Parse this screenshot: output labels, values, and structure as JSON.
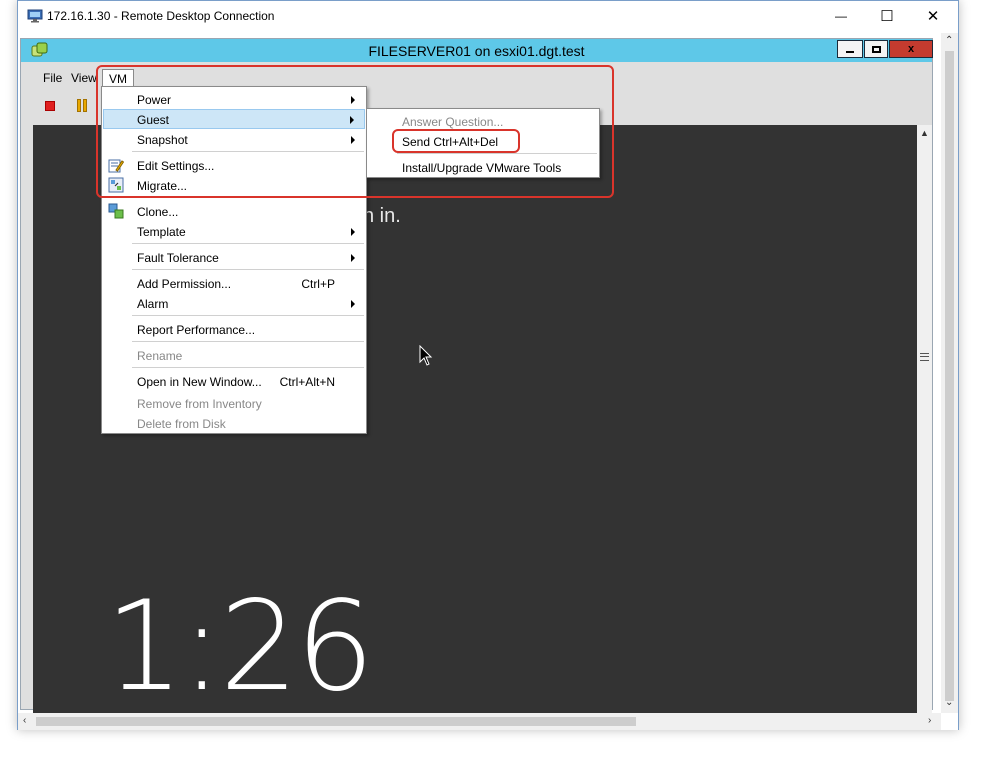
{
  "rdp": {
    "title": "172.16.1.30 - Remote Desktop Connection",
    "minimize_glyph": "—",
    "maximize_glyph": "☐",
    "close_glyph": "✕"
  },
  "vsphere": {
    "title": "FILESERVER01 on esxi01.dgt.test",
    "close_glyph": "x"
  },
  "menubar": {
    "file": "File",
    "view": "View",
    "vm": "VM"
  },
  "vm_menu": {
    "power": "Power",
    "guest": "Guest",
    "snapshot": "Snapshot",
    "edit_settings": "Edit Settings...",
    "migrate": "Migrate...",
    "clone": "Clone...",
    "template": "Template",
    "fault_tolerance": "Fault Tolerance",
    "add_permission": "Add Permission...",
    "add_permission_shortcut": "Ctrl+P",
    "alarm": "Alarm",
    "report_performance": "Report Performance...",
    "rename": "Rename",
    "open_new_window": "Open in New Window...",
    "open_new_window_shortcut": "Ctrl+Alt+N",
    "remove_inventory": "Remove from Inventory",
    "delete_disk": "Delete from Disk"
  },
  "guest_menu": {
    "answer_question": "Answer Question...",
    "send_cad": "Send Ctrl+Alt+Del",
    "install_tools": "Install/Upgrade VMware Tools"
  },
  "lockscreen": {
    "signin_partial": "n in.",
    "time": "1:26"
  },
  "colors": {
    "titlebar": "#5ec8e8",
    "console_bg": "#333333",
    "annotation": "#d9342b",
    "menu_highlight": "#cde6f7"
  },
  "icons": {
    "rdp_app": "rdp-monitor-icon",
    "vsphere": "vsphere-icon",
    "stop": "stop-icon",
    "pause": "pause-icon",
    "edit_settings": "edit-settings-icon",
    "migrate": "migrate-icon",
    "clone": "clone-icon"
  }
}
